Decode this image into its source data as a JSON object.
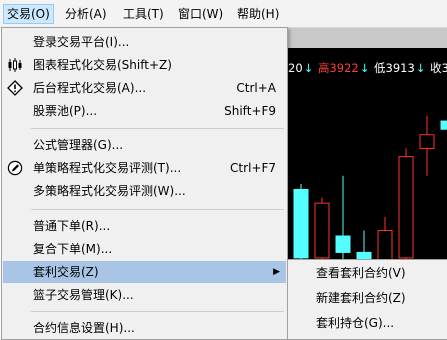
{
  "menubar": [
    {
      "label": "交易(O)"
    },
    {
      "label": "分析(A)"
    },
    {
      "label": "工具(T)"
    },
    {
      "label": "窗口(W)"
    },
    {
      "label": "帮助(H)"
    }
  ],
  "chart": {
    "info": {
      "t1": "20",
      "a1": "↓",
      "t2": "高3922",
      "a2": "↓",
      "t3": "低3913",
      "a3": "↓",
      "t4": "收39"
    },
    "colors": {
      "up": "#ff3232",
      "down": "#54ffff",
      "text_up": "#ff3c3c",
      "text_down": "#54ffff",
      "text_neutral": "#ffffff"
    },
    "candles": [
      {
        "o": 3895,
        "h": 3897,
        "l": 3862,
        "c": 3870
      },
      {
        "o": 3870,
        "h": 3892,
        "l": 3868,
        "c": 3890
      },
      {
        "o": 3878,
        "h": 3900,
        "l": 3860,
        "c": 3872
      },
      {
        "o": 3872,
        "h": 3880,
        "l": 3850,
        "c": 3855
      },
      {
        "o": 3860,
        "h": 3885,
        "l": 3852,
        "c": 3880
      },
      {
        "o": 3870,
        "h": 3910,
        "l": 3865,
        "c": 3907
      },
      {
        "o": 3910,
        "h": 3922,
        "l": 3900,
        "c": 3915
      },
      {
        "o": 3920,
        "h": 3927,
        "l": 3908,
        "c": 3917
      }
    ]
  },
  "menu": {
    "items": [
      {
        "label": "登录交易平台(I)...",
        "shortcut": "",
        "icon": ""
      },
      {
        "label": "图表程式化交易(Shift+Z)",
        "shortcut": "",
        "icon": "candlestick-icon"
      },
      {
        "label": "后台程式化交易(A)...",
        "shortcut": "Ctrl+A",
        "icon": "alert-icon"
      },
      {
        "label": "股票池(P)...",
        "shortcut": "Shift+F9",
        "icon": ""
      },
      {
        "label": "公式管理器(G)...",
        "shortcut": "",
        "icon": ""
      },
      {
        "label": "单策略程式化交易评测(T)...",
        "shortcut": "Ctrl+F7",
        "icon": "pencil-icon"
      },
      {
        "label": "多策略程式化交易评测(W)...",
        "shortcut": "",
        "icon": ""
      },
      {
        "label": "普通下单(R)...",
        "shortcut": "",
        "icon": ""
      },
      {
        "label": "复合下单(M)...",
        "shortcut": "",
        "icon": ""
      },
      {
        "label": "套利交易(Z)",
        "shortcut": "",
        "icon": "",
        "submenu": true
      },
      {
        "label": "篮子交易管理(K)...",
        "shortcut": "",
        "icon": ""
      },
      {
        "label": "合约信息设置(H)...",
        "shortcut": "",
        "icon": ""
      }
    ],
    "submenu_arrow": "▶"
  },
  "submenu": {
    "items": [
      {
        "label": "查看套利合约(V)"
      },
      {
        "label": "新建套利合约(Z)"
      },
      {
        "label": "套利持仓(G)..."
      }
    ]
  }
}
